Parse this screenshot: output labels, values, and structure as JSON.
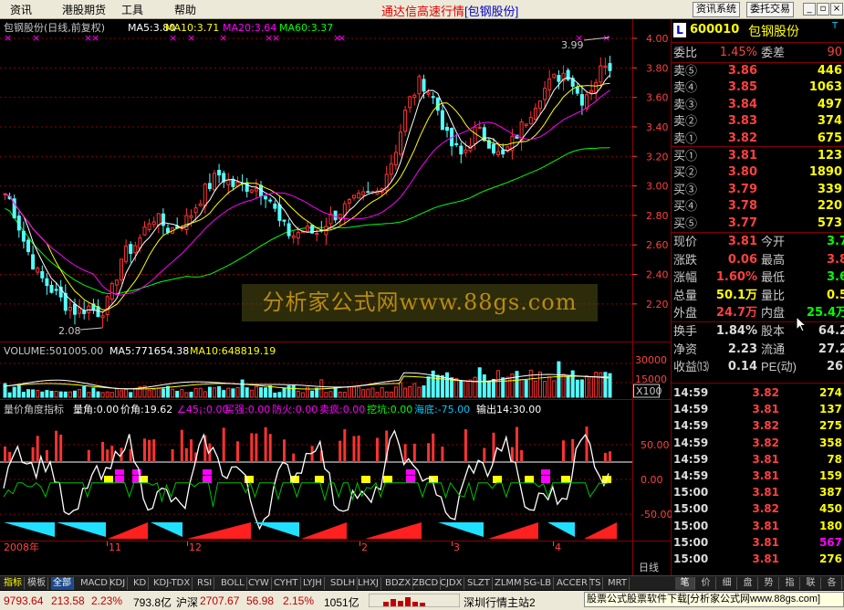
{
  "menu": {
    "items": [
      "资讯",
      "港股期货",
      "工具",
      "帮助"
    ],
    "title_main": "通达信高速行情",
    "title_stock": "[包钢股份]",
    "btn_news": "资讯系统",
    "btn_trade": "委托交易"
  },
  "chart": {
    "header": "包钢股份(日线,前复权)",
    "ma": [
      {
        "label": "MA5:3.80",
        "color": "#ffffff"
      },
      {
        "label": "MA10:3.71",
        "color": "#ffff00"
      },
      {
        "label": "MA20:3.64",
        "color": "#ff00ff"
      },
      {
        "label": "MA60:3.37",
        "color": "#00ff00"
      }
    ],
    "price_ticks": [
      "4.00",
      "3.80",
      "3.60",
      "3.40",
      "3.20",
      "3.00",
      "2.80",
      "2.60",
      "2.40",
      "2.20"
    ],
    "high_note": "3.99",
    "low_note": "2.08",
    "volume_header": "VOLUME:501005.00",
    "vol_ma5": "MA5:771654.38",
    "vol_ma10": "MA10:648819.19",
    "vol_ticks": [
      "30000",
      "15000"
    ],
    "vol_unit": "X100",
    "ind_header": [
      {
        "label": "量价角度指标",
        "color": "#c8c8c8"
      },
      {
        "label": "量角:0.00",
        "color": "#ffffff"
      },
      {
        "label": "价角:19.62",
        "color": "#ffffff"
      },
      {
        "label": "∠45¡:0.00",
        "color": "#ff00ff"
      },
      {
        "label": "买强:0.00",
        "color": "#ff00ff"
      },
      {
        "label": "防火:0.00",
        "color": "#ff00ff"
      },
      {
        "label": "卖疯:0.00",
        "color": "#ff00ff"
      },
      {
        "label": "挖坑:0.00",
        "color": "#00ff00"
      },
      {
        "label": "海底:-75.00",
        "color": "#00c8ff"
      },
      {
        "label": "输出14:30.00",
        "color": "#ffffff"
      }
    ],
    "ind_ticks": [
      "50.00",
      "0.00",
      "-50.00"
    ],
    "dates": [
      "2008年",
      "11",
      "12",
      "2",
      "3",
      "4"
    ],
    "date_right": "日线"
  },
  "quote": {
    "code": "600010",
    "name": "包钢股份",
    "badge": "L",
    "wb_label": "委比",
    "wb_value": "1.45%",
    "wc_label": "委差",
    "wc_value": "90",
    "asks": [
      {
        "l": "卖⑤",
        "p": "3.86",
        "v": "446"
      },
      {
        "l": "卖④",
        "p": "3.85",
        "v": "1063"
      },
      {
        "l": "卖③",
        "p": "3.84",
        "v": "497"
      },
      {
        "l": "卖②",
        "p": "3.83",
        "v": "374"
      },
      {
        "l": "卖①",
        "p": "3.82",
        "v": "675"
      }
    ],
    "bids": [
      {
        "l": "买①",
        "p": "3.81",
        "v": "123"
      },
      {
        "l": "买②",
        "p": "3.80",
        "v": "1890"
      },
      {
        "l": "买③",
        "p": "3.79",
        "v": "339"
      },
      {
        "l": "买④",
        "p": "3.78",
        "v": "220"
      },
      {
        "l": "买⑤",
        "p": "3.77",
        "v": "573"
      }
    ],
    "stats": [
      {
        "l1": "现价",
        "v1": "3.81",
        "c1": "#ff4040",
        "l2": "今开",
        "v2": "3.7",
        "c2": "#00ff00"
      },
      {
        "l1": "涨跌",
        "v1": "0.06",
        "c1": "#ff4040",
        "l2": "最高",
        "v2": "3.8",
        "c2": "#ff4040"
      },
      {
        "l1": "涨幅",
        "v1": "1.60%",
        "c1": "#ff4040",
        "l2": "最低",
        "v2": "3.6",
        "c2": "#00ff00"
      },
      {
        "l1": "总量",
        "v1": "50.1万",
        "c1": "#ffff00",
        "l2": "量比",
        "v2": "0.5",
        "c2": "#ffff00"
      },
      {
        "l1": "外盘",
        "v1": "24.7万",
        "c1": "#ff4040",
        "l2": "内盘",
        "v2": "25.4万",
        "c2": "#00ff00"
      }
    ],
    "stats2": [
      {
        "l1": "换手",
        "v1": "1.84%",
        "c1": "#dcdcdc",
        "l2": "股本",
        "v2": "64.2",
        "c2": "#dcdcdc"
      },
      {
        "l1": "净资",
        "v1": "2.23",
        "c1": "#dcdcdc",
        "l2": "流通",
        "v2": "27.2",
        "c2": "#dcdcdc"
      },
      {
        "l1": "收益⒀",
        "v1": "0.14",
        "c1": "#dcdcdc",
        "l2": "PE(动)",
        "v2": "26.",
        "c2": "#dcdcdc"
      }
    ],
    "ticks": [
      {
        "t": "14:59",
        "p": "3.82",
        "v": "274",
        "pc": "#ff4040",
        "vc": "#ffff00"
      },
      {
        "t": "14:59",
        "p": "3.81",
        "v": "137",
        "pc": "#ff4040",
        "vc": "#ffff00"
      },
      {
        "t": "14:59",
        "p": "3.82",
        "v": "275",
        "pc": "#ff4040",
        "vc": "#ffff00"
      },
      {
        "t": "14:59",
        "p": "3.82",
        "v": "358",
        "pc": "#ff4040",
        "vc": "#ffff00"
      },
      {
        "t": "14:59",
        "p": "3.81",
        "v": "78",
        "pc": "#ff4040",
        "vc": "#ffff00"
      },
      {
        "t": "14:59",
        "p": "3.81",
        "v": "159",
        "pc": "#ff4040",
        "vc": "#ffff00"
      },
      {
        "t": "15:00",
        "p": "3.81",
        "v": "387",
        "pc": "#ff4040",
        "vc": "#ffff00"
      },
      {
        "t": "15:00",
        "p": "3.82",
        "v": "450",
        "pc": "#ff4040",
        "vc": "#ffff00"
      },
      {
        "t": "15:00",
        "p": "3.81",
        "v": "180",
        "pc": "#ff4040",
        "vc": "#ffff00"
      },
      {
        "t": "15:00",
        "p": "3.81",
        "v": "567",
        "pc": "#ff4040",
        "vc": "#ff00ff"
      },
      {
        "t": "15:00",
        "p": "3.81",
        "v": "276",
        "pc": "#ff4040",
        "vc": "#ffff00"
      }
    ]
  },
  "tabs": [
    "指标",
    "模板",
    "全部",
    "MACD",
    "KDJ",
    "KD",
    "KDJ-TDX",
    "RSI",
    "BOLL",
    "CYW",
    "CYHT",
    "LYJH",
    "SDLH",
    "LHXJ",
    "BDZX",
    "ZBCD",
    "CJDX",
    "SLZT",
    "ZLMM",
    "SG-LB",
    "ACCER",
    "TS",
    "MRT"
  ],
  "rtabs": [
    "笔",
    "价",
    "细",
    "盘",
    "势",
    "指",
    "联",
    "各"
  ],
  "status": {
    "sh_index": "9793.64",
    "sh_chg": "213.58",
    "sh_pct": "2.23%",
    "sh_amt": "793.8亿",
    "sz_label": "沪深",
    "sz_index": "2707.67",
    "sz_chg": "56.98",
    "sz_pct": "2.15%",
    "sz_amt": "1051亿",
    "server": "深圳行情主站2",
    "ad": "股票公式股票软件下载[分析家公式网www.88gs.com]"
  },
  "watermark": "分析家公式网www.88gs.com",
  "colors": {
    "up": "#ff3232",
    "down": "#54ffff",
    "ma5": "#ffffff",
    "ma10": "#ffff00",
    "ma20": "#ff00ff",
    "ma60": "#00ff00",
    "grid": "#8b0000"
  }
}
